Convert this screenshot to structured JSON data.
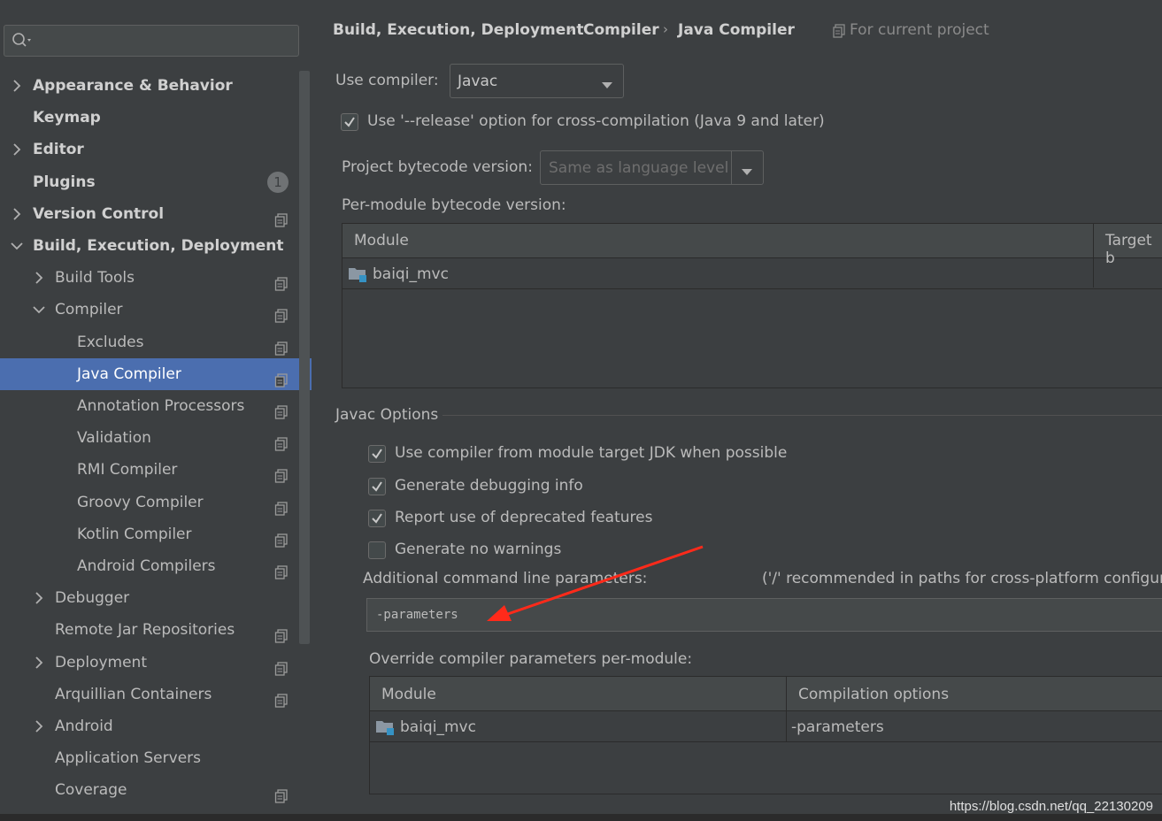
{
  "search": {
    "placeholder": ""
  },
  "sidebar": {
    "items": [
      {
        "label": "Appearance & Behavior",
        "level": 0,
        "bold": true,
        "chevron": "right",
        "project_icon": false
      },
      {
        "label": "Keymap",
        "level": 0,
        "bold": true,
        "chevron": "none",
        "project_icon": false
      },
      {
        "label": "Editor",
        "level": 0,
        "bold": true,
        "chevron": "right",
        "project_icon": false
      },
      {
        "label": "Plugins",
        "level": 0,
        "bold": true,
        "chevron": "none",
        "project_icon": false,
        "badge": "1"
      },
      {
        "label": "Version Control",
        "level": 0,
        "bold": true,
        "chevron": "right",
        "project_icon": true
      },
      {
        "label": "Build, Execution, Deployment",
        "level": 0,
        "bold": true,
        "chevron": "down",
        "project_icon": false
      },
      {
        "label": "Build Tools",
        "level": 1,
        "bold": false,
        "chevron": "right",
        "project_icon": true
      },
      {
        "label": "Compiler",
        "level": 1,
        "bold": false,
        "chevron": "down",
        "project_icon": true
      },
      {
        "label": "Excludes",
        "level": 2,
        "bold": false,
        "chevron": "none",
        "project_icon": true
      },
      {
        "label": "Java Compiler",
        "level": 2,
        "bold": false,
        "chevron": "none",
        "project_icon": true,
        "selected": true
      },
      {
        "label": "Annotation Processors",
        "level": 2,
        "bold": false,
        "chevron": "none",
        "project_icon": true
      },
      {
        "label": "Validation",
        "level": 2,
        "bold": false,
        "chevron": "none",
        "project_icon": true
      },
      {
        "label": "RMI Compiler",
        "level": 2,
        "bold": false,
        "chevron": "none",
        "project_icon": true
      },
      {
        "label": "Groovy Compiler",
        "level": 2,
        "bold": false,
        "chevron": "none",
        "project_icon": true
      },
      {
        "label": "Kotlin Compiler",
        "level": 2,
        "bold": false,
        "chevron": "none",
        "project_icon": true
      },
      {
        "label": "Android Compilers",
        "level": 2,
        "bold": false,
        "chevron": "none",
        "project_icon": true
      },
      {
        "label": "Debugger",
        "level": 1,
        "bold": false,
        "chevron": "right",
        "project_icon": false
      },
      {
        "label": "Remote Jar Repositories",
        "level": 1,
        "bold": false,
        "chevron": "none",
        "project_icon": true
      },
      {
        "label": "Deployment",
        "level": 1,
        "bold": false,
        "chevron": "right",
        "project_icon": true
      },
      {
        "label": "Arquillian Containers",
        "level": 1,
        "bold": false,
        "chevron": "none",
        "project_icon": true
      },
      {
        "label": "Android",
        "level": 1,
        "bold": false,
        "chevron": "right",
        "project_icon": false
      },
      {
        "label": "Application Servers",
        "level": 1,
        "bold": false,
        "chevron": "none",
        "project_icon": false
      },
      {
        "label": "Coverage",
        "level": 1,
        "bold": false,
        "chevron": "none",
        "project_icon": true
      }
    ]
  },
  "breadcrumb": {
    "items": [
      "Build, Execution, Deployment",
      "Compiler",
      "Java Compiler"
    ],
    "scope": "For current project"
  },
  "compiler": {
    "use_compiler_label": "Use compiler:",
    "use_compiler_value": "Javac",
    "release_option": {
      "label": "Use '--release' option for cross-compilation (Java 9 and later)",
      "checked": true
    },
    "bytecode_label": "Project bytecode version:",
    "bytecode_value": "Same as language level",
    "per_module_label": "Per-module bytecode version:",
    "module_table": {
      "headers": [
        "Module",
        "Target b"
      ],
      "rows": [
        [
          "baiqi_mvc",
          ""
        ]
      ]
    }
  },
  "javac": {
    "group_title": "Javac Options",
    "options": [
      {
        "label": "Use compiler from module target JDK when possible",
        "checked": true
      },
      {
        "label": "Generate debugging info",
        "checked": true
      },
      {
        "label": "Report use of deprecated features",
        "checked": true
      },
      {
        "label": "Generate no warnings",
        "checked": false
      }
    ],
    "additional_label": "Additional command line parameters:",
    "additional_hint": "('/' recommended in paths for cross-platform configurat",
    "additional_value": "-parameters",
    "override_label": "Override compiler parameters per-module:",
    "override_table": {
      "headers": [
        "Module",
        "Compilation options"
      ],
      "rows": [
        [
          "baiqi_mvc",
          "-parameters"
        ]
      ]
    }
  },
  "watermark": "https://blog.csdn.net/qq_22130209",
  "colors": {
    "selection": "#4b6eaf",
    "background": "#3c3f41",
    "arrow": "#ff2a1a"
  }
}
